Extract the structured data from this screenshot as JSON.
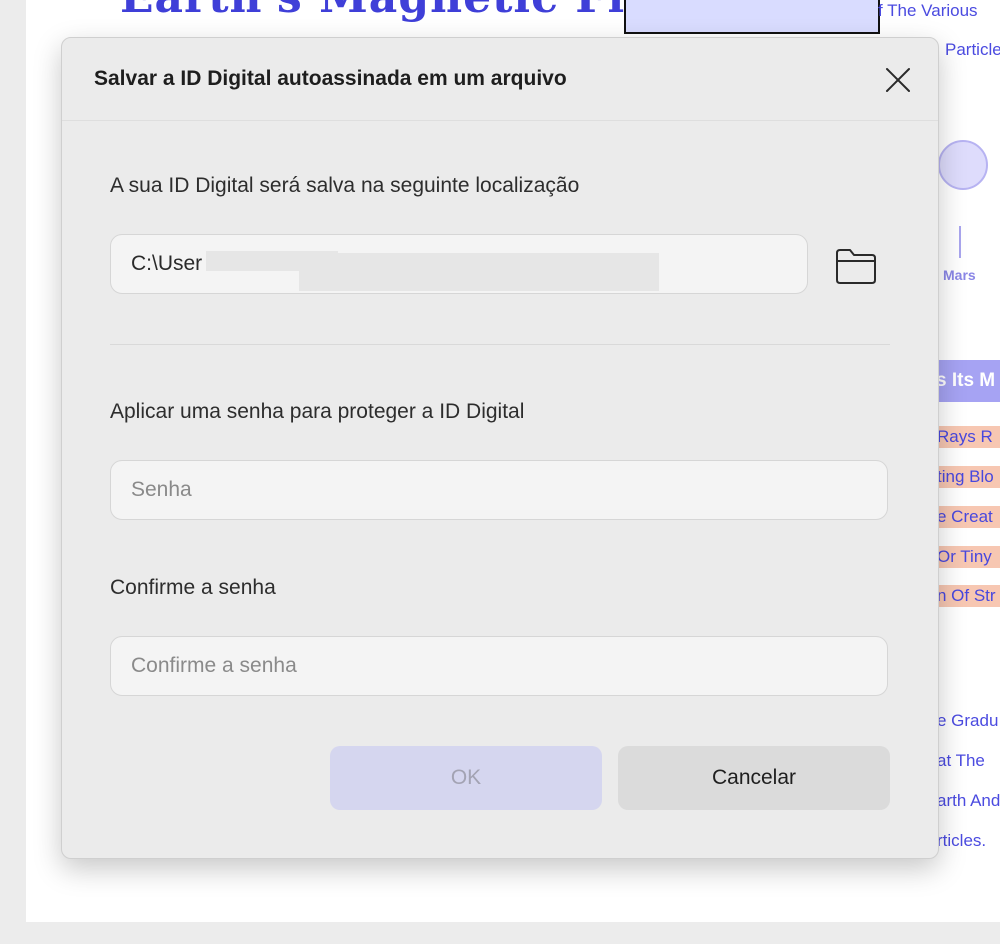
{
  "background": {
    "title": "Earth's Magnetic Fie",
    "texts": [
      "f The Various",
      "Particle",
      "e Gradu",
      "at The",
      "arth And",
      "rticles."
    ],
    "planet_label": "Mars",
    "band_text": "s Its M",
    "highlights": [
      "Rays R",
      "ting Blo",
      "e Creat",
      "Or Tiny",
      "n Of Str"
    ]
  },
  "dialog": {
    "title": "Salvar a ID Digital autoassinada em um arquivo",
    "close_icon": "close-icon",
    "location_label": "A sua ID Digital será salva na seguinte localização",
    "path_value": "C:\\User",
    "folder_icon": "folder-icon",
    "password_label": "Aplicar uma senha para proteger a ID Digital",
    "password_placeholder": "Senha",
    "confirm_label": "Confirme a senha",
    "confirm_placeholder": "Confirme a senha",
    "ok_label": "OK",
    "cancel_label": "Cancelar"
  },
  "colors": {
    "dialog_bg": "#ebebeb",
    "ok_disabled_bg": "#d5d6ef",
    "cancel_bg": "#dbdbdb",
    "background_link": "#4b4be0"
  }
}
